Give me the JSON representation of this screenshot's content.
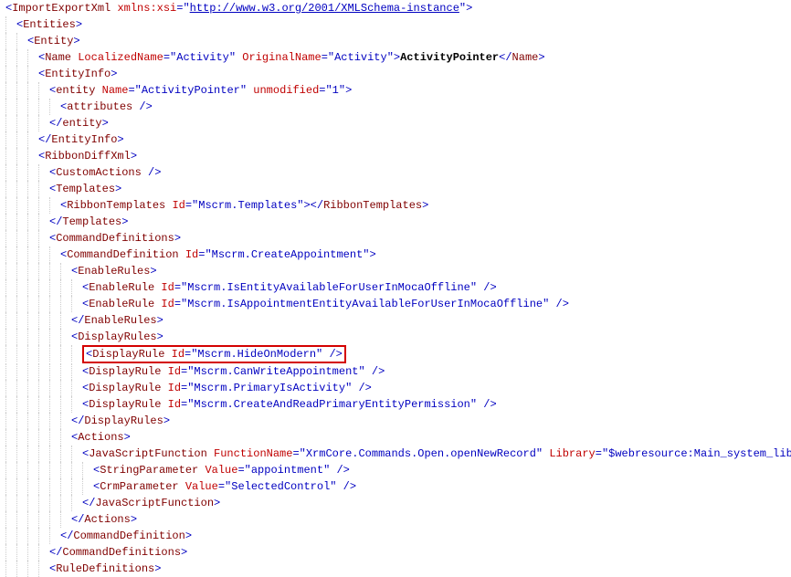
{
  "xml": {
    "root": {
      "tag": "ImportExportXml",
      "ns_attr": "xmlns:xsi",
      "ns_val": "http://www.w3.org/2001/XMLSchema-instance"
    },
    "entities_open": "Entities",
    "entity_open": "Entity",
    "name_tag": "Name",
    "name_attr1": "LocalizedName",
    "name_val1": "Activity",
    "name_attr2": "OriginalName",
    "name_val2": "Activity",
    "name_text": "ActivityPointer",
    "entityinfo": "EntityInfo",
    "entity_lc_tag": "entity",
    "entity_lc_attr1": "Name",
    "entity_lc_val1": "ActivityPointer",
    "entity_lc_attr2": "unmodified",
    "entity_lc_val2": "1",
    "attributes_tag": "attributes",
    "ribbondiffxml": "RibbonDiffXml",
    "customactions": "CustomActions",
    "templates": "Templates",
    "ribbontemplates": "RibbonTemplates",
    "ribbontemplates_attr": "Id",
    "ribbontemplates_val": "Mscrm.Templates",
    "commanddefs": "CommandDefinitions",
    "commanddef": "CommandDefinition",
    "commanddef_attr": "Id",
    "commanddef_val": "Mscrm.CreateAppointment",
    "enablerules": "EnableRules",
    "enablerule": "EnableRule",
    "id_attr": "Id",
    "enablerule1_val": "Mscrm.IsEntityAvailableForUserInMocaOffline",
    "enablerule2_val": "Mscrm.IsAppointmentEntityAvailableForUserInMocaOffline",
    "displayrules": "DisplayRules",
    "displayrule": "DisplayRule",
    "displayrule1_val": "Mscrm.HideOnModern",
    "displayrule2_val": "Mscrm.CanWriteAppointment",
    "displayrule3_val": "Mscrm.PrimaryIsActivity",
    "displayrule4_val": "Mscrm.CreateAndReadPrimaryEntityPermission",
    "actions": "Actions",
    "jsfunc": "JavaScriptFunction",
    "jsfunc_attr1": "FunctionName",
    "jsfunc_val1": "XrmCore.Commands.Open.openNewRecord",
    "jsfunc_attr2": "Library",
    "jsfunc_val2": "$webresource:Main_system_library.js",
    "stringparam": "StringParameter",
    "stringparam_attr": "Value",
    "stringparam_val": "appointment",
    "crmparam": "CrmParameter",
    "crmparam_attr": "Value",
    "crmparam_val": "SelectedControl",
    "ruledefs": "RuleDefinitions"
  }
}
